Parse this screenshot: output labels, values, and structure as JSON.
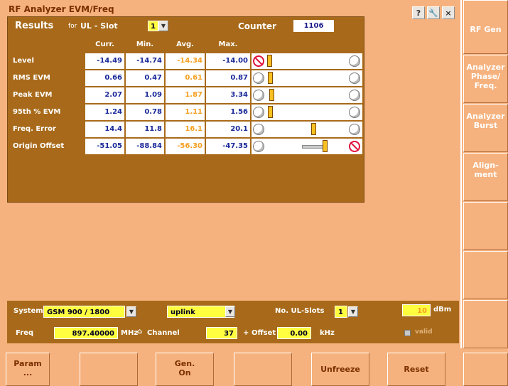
{
  "window": {
    "title": "RF Analyzer EVM/Freq",
    "help_glyph": "?",
    "tool_glyph": "🔧",
    "close_glyph": "×"
  },
  "results": {
    "title": "Results",
    "for_label": "for",
    "slot_label": "UL - Slot",
    "slot_value": "1",
    "counter_label": "Counter",
    "counter_value": "1106",
    "columns": [
      "Curr.",
      "Min.",
      "Avg.",
      "Max."
    ],
    "rows": [
      {
        "label": "Level",
        "curr": "-14.49",
        "min": "-14.74",
        "avg": "-14.34",
        "max": "-14.00",
        "left_state": "forbidden",
        "right_state": "ok",
        "marker_pct": 0.02,
        "spread": null
      },
      {
        "label": "RMS EVM",
        "curr": "0.66",
        "min": "0.47",
        "avg": "0.61",
        "max": "0.87",
        "left_state": "ok",
        "right_state": "ok",
        "marker_pct": 0.03,
        "spread": null
      },
      {
        "label": "Peak EVM",
        "curr": "2.07",
        "min": "1.09",
        "avg": "1.87",
        "max": "3.34",
        "left_state": "ok",
        "right_state": "ok",
        "marker_pct": 0.04,
        "spread": null
      },
      {
        "label": "95th % EVM",
        "curr": "1.24",
        "min": "0.78",
        "avg": "1.11",
        "max": "1.56",
        "left_state": "ok",
        "right_state": "ok",
        "marker_pct": 0.03,
        "spread": null
      },
      {
        "label": "Freq. Error",
        "curr": "14.4",
        "min": "11.8",
        "avg": "16.1",
        "max": "20.1",
        "left_state": "ok",
        "right_state": "ok",
        "marker_pct": 0.56,
        "spread": null
      },
      {
        "label": "Origin Offset",
        "curr": "-51.05",
        "min": "-88.84",
        "avg": "-56.30",
        "max": "-47.35",
        "left_state": "ok",
        "right_state": "forbidden",
        "marker_pct": 0.7,
        "spread": [
          0.45,
          0.73
        ]
      }
    ]
  },
  "sidebar": {
    "buttons": [
      "RF Gen",
      "Analyzer Phase/ Freq.",
      "Analyzer Burst",
      "Align- ment",
      "",
      "",
      ""
    ]
  },
  "settings": {
    "system_label": "System",
    "system_value": "GSM 900 / 1800",
    "link_value": "uplink",
    "ul_slots_label": "No. UL-Slots",
    "ul_slots_value": "1",
    "level_value": "10",
    "level_unit": "dBm",
    "valid_label": "valid",
    "freq_label": "Freq",
    "freq_value": "897.40000",
    "freq_unit": "MHz",
    "lock_glyph": "⌂",
    "channel_label": "Channel",
    "channel_value": "37",
    "plus": "+",
    "offset_label": "Offset",
    "offset_value": "0.00",
    "offset_unit": "kHz"
  },
  "softkeys": {
    "param": "Param\n...",
    "gen_on": "Gen.\nOn",
    "unfreeze": "Unfreeze",
    "reset": "Reset"
  }
}
